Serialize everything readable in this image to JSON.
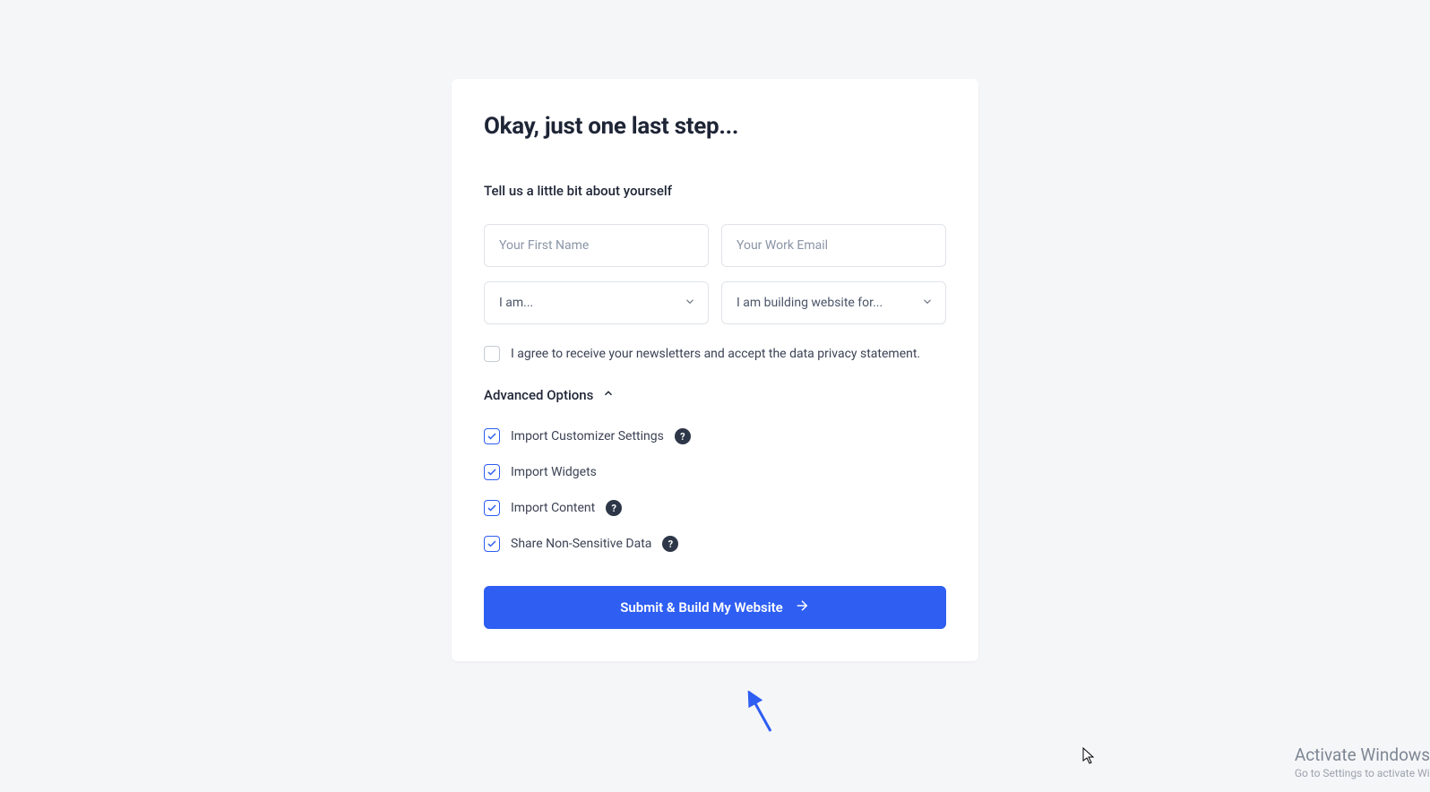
{
  "title": "Okay, just one last step...",
  "subtitle": "Tell us a little bit about yourself",
  "form": {
    "first_name_placeholder": "Your First Name",
    "email_placeholder": "Your Work Email",
    "role_selected": "I am...",
    "purpose_selected": "I am building website for..."
  },
  "agree_text": "I agree to receive your newsletters and accept the data privacy statement.",
  "advanced_label": "Advanced Options",
  "options": {
    "import_customizer": "Import Customizer Settings",
    "import_widgets": "Import Widgets",
    "import_content": "Import Content",
    "share_data": "Share Non-Sensitive Data"
  },
  "submit_label": "Submit & Build My Website",
  "watermark": {
    "title": "Activate Windows",
    "sub": "Go to Settings to activate Wi"
  }
}
